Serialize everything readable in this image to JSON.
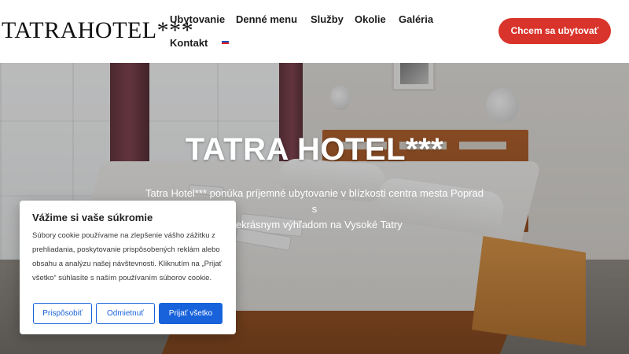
{
  "header": {
    "logo": "TATRAHOTEL***",
    "nav": [
      {
        "label": "Ubytovanie"
      },
      {
        "label": "Denné menu"
      },
      {
        "label": "Služby"
      },
      {
        "label": "Okolie"
      },
      {
        "label": "Galéria"
      },
      {
        "label": "Kontakt"
      }
    ],
    "language_flag": "sk-flag-icon",
    "cta_label": "Chcem sa ubytovať"
  },
  "hero": {
    "title": "TATRA HOTEL***",
    "text_line1": "Tatra Hotel*** ponúka príjemné ubytovanie v blízkosti centra mesta Poprad s",
    "text_line2": "prekrásnym výhľadom na Vysoké Tatry"
  },
  "cookie": {
    "title": "Vážime si vaše súkromie",
    "text": "Súbory cookie používame na zlepšenie vášho zážitku z prehliadania, poskytovanie prispôsobených reklám alebo obsahu a analýzu našej návštevnosti. Kliknutím na „Prijať všetko“ súhlasíte s naším používaním súborov cookie.",
    "buttons": {
      "customize": "Prispôsobiť",
      "reject": "Odmietnuť",
      "accept": "Prijať všetko"
    }
  },
  "colors": {
    "cta": "#d9342b",
    "cookie_accent": "#1863dc"
  }
}
